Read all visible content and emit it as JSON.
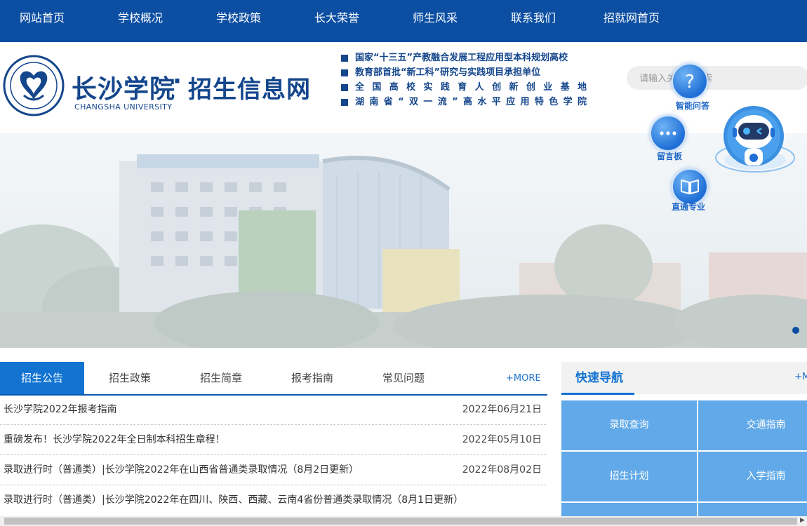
{
  "nav": {
    "items": [
      "网站首页",
      "学校概况",
      "学校政策",
      "长大荣誉",
      "师生风采",
      "联系我们",
      "招就网首页"
    ]
  },
  "header": {
    "logo_cn": "长沙学院",
    "logo_dot": "·",
    "logo_subtitle": "招生信息网",
    "logo_en": "CHANGSHA UNIVERSITY",
    "slogans": [
      "国家“十三五”产教融合发展工程应用型本科规划高校",
      "教育部首批“新工科”研究与实践项目承担单位",
      "全国高校实践育人创新创业基地",
      "湖南省“双一流”高水平应用特色学院"
    ],
    "search_placeholder": "请输入关键词搜索"
  },
  "floating": {
    "qa_label": "智能问答",
    "board_label": "留言板",
    "major_label": "直通专业"
  },
  "news": {
    "tabs": [
      "招生公告",
      "招生政策",
      "招生简章",
      "报考指南",
      "常见问题"
    ],
    "more": "+MORE",
    "items": [
      {
        "title": "长沙学院2022年报考指南",
        "date": "2022年06月21日"
      },
      {
        "title": "重磅发布！长沙学院2022年全日制本科招生章程！",
        "date": "2022年05月10日"
      },
      {
        "title": "录取进行时（普通类）|长沙学院2022年在山西省普通类录取情况（8月2日更新）",
        "date": "2022年08月02日"
      },
      {
        "title": "录取进行时（普通类）|长沙学院2022年在四川、陕西、西藏、云南4省份普通类录取情况（8月1日更新）",
        "date": ""
      }
    ]
  },
  "quick_nav": {
    "title": "快速导航",
    "more": "+M",
    "items": [
      "录取查询",
      "交通指南",
      "招生计划",
      "入学指南"
    ]
  },
  "colors": {
    "nav_bg": "#0b4ea2",
    "brand": "#14468c",
    "tab_active": "#1273d1",
    "quick_cell": "#61a9e8"
  }
}
